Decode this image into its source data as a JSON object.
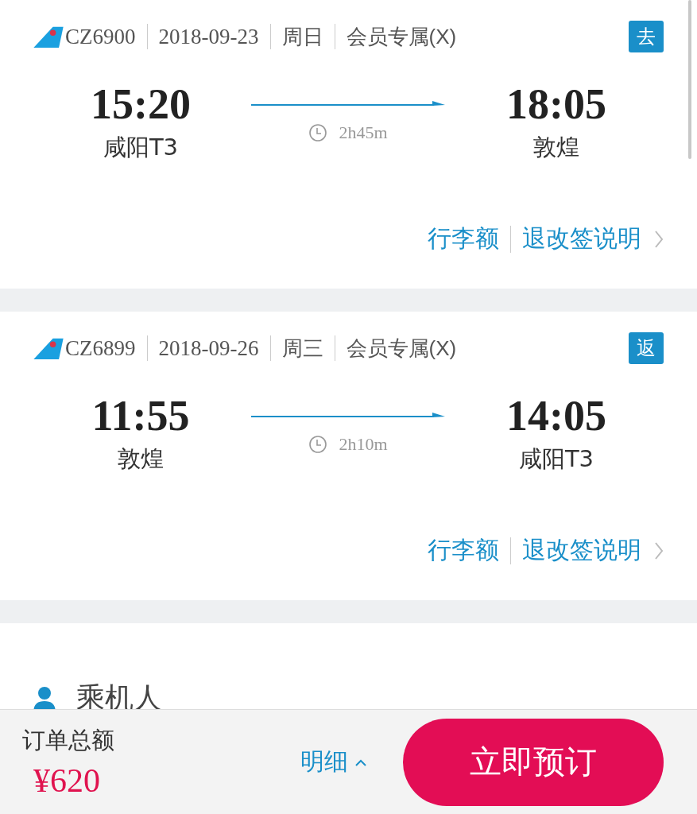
{
  "flights": [
    {
      "flight_no": "CZ6900",
      "date": "2018-09-23",
      "weekday": "周日",
      "fare": "会员专属(X)",
      "direction": "去",
      "depart_time": "15:20",
      "depart_airport": "咸阳T3",
      "duration": "2h45m",
      "arrive_time": "18:05",
      "arrive_airport": "敦煌",
      "links": [
        "行李额",
        "退改签说明"
      ]
    },
    {
      "flight_no": "CZ6899",
      "date": "2018-09-26",
      "weekday": "周三",
      "fare": "会员专属(X)",
      "direction": "返",
      "depart_time": "11:55",
      "depart_airport": "敦煌",
      "duration": "2h10m",
      "arrive_time": "14:05",
      "arrive_airport": "咸阳T3",
      "links": [
        "行李额",
        "退改签说明"
      ]
    }
  ],
  "passengers": {
    "title": "乘机人"
  },
  "bottom_bar": {
    "total_label": "订单总额",
    "total": "¥620",
    "details": "明细",
    "book_button": "立即预订"
  }
}
